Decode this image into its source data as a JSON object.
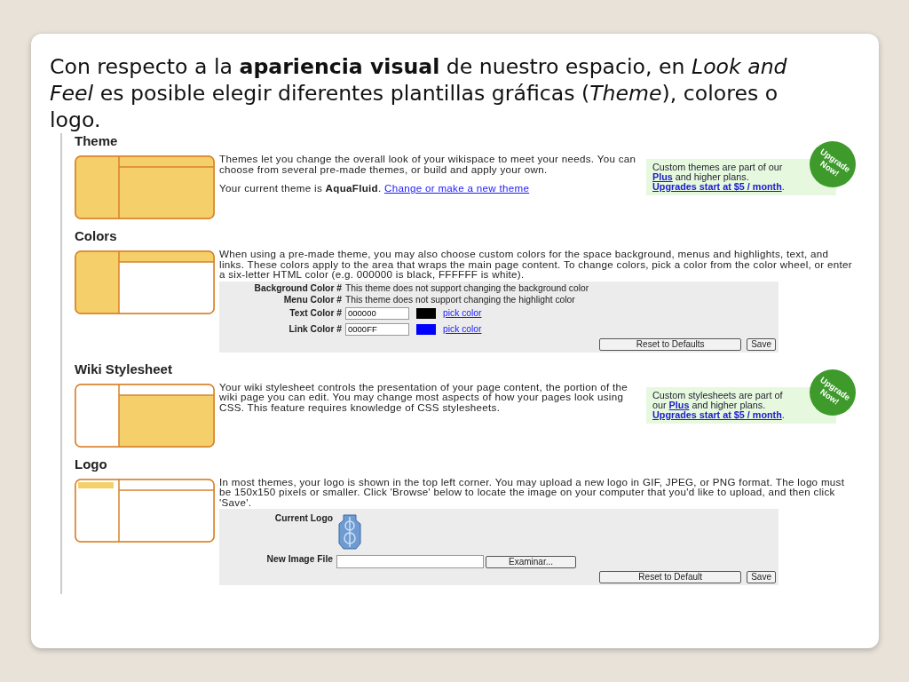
{
  "intro": "Con respecto a la **apariencia visual** de nuestro espacio, en *Look and Feel* es posible elegir diferentes plantillas gráficas (*Theme*), colores o logo.",
  "sections": [
    {
      "title": "Theme",
      "kind": "all",
      "description": "Themes let you change the overall look of your wikispace to meet your needs. You can choose from several pre-made themes, or build and apply your own.",
      "current": "Your current theme is **AquaFluid**.",
      "current_link": "Change or make a new theme",
      "upgrade": {
        "parts": [
          {
            "kind": "text",
            "text": "Custom themes are part of our"
          },
          {
            "kind": "link",
            "text": "Plus"
          },
          {
            "kind": "text",
            "text": "and higher plans."
          },
          {
            "kind": "link",
            "text": "Upgrades start at $5 / month"
          },
          {
            "kind": "text",
            "text": "."
          }
        ],
        "badge": "Upgrade Now!"
      }
    },
    {
      "title": "Colors",
      "kind": "frame",
      "description": "When using a pre-made theme, you may also choose custom colors for the space background, menus and highlights, text, and links. These colors apply to the area that wraps the main page content. To change colors, pick a color from the color wheel, or enter a six-letter HTML color (e.g. 000000 is black, FFFFFF is white).",
      "color_settings": {
        "rows": [
          {
            "kind": "note",
            "label": "Background Color #",
            "text": "This theme does not support changing the background color"
          },
          {
            "kind": "note",
            "label": "Menu Color #",
            "text": "This theme does not support changing the highlight color"
          },
          {
            "kind": "picker",
            "label": "Text Color #",
            "value": "000000",
            "color": "#000000",
            "link": "pick color"
          },
          {
            "kind": "picker",
            "label": "Link Color #",
            "value": "0000FF",
            "color": "#0000ff",
            "link": "pick color"
          }
        ],
        "buttons": [
          "Reset to Defaults",
          "Save"
        ]
      }
    },
    {
      "title": "Wiki Stylesheet",
      "kind": "content",
      "description": "Your wiki stylesheet controls the presentation of your page content, the portion of the wiki page you can edit. You may change most aspects of how your pages look using CSS. This feature requires knowledge of CSS stylesheets.",
      "upgrade": {
        "parts": [
          {
            "kind": "text",
            "text": "Custom stylesheets are part of our"
          },
          {
            "kind": "link",
            "text": "Plus"
          },
          {
            "kind": "text",
            "text": "and higher plans."
          },
          {
            "kind": "link",
            "text": "Upgrades start at $5 / month"
          },
          {
            "kind": "text",
            "text": "."
          }
        ],
        "badge": "Upgrade Now!"
      }
    },
    {
      "title": "Logo",
      "kind": "logo",
      "description": "In most themes, your logo is shown in the top left corner. You may upload a new logo in GIF, JPEG, or PNG format. The logo must be 150x150 pixels or smaller. Click 'Browse' below to locate the image on your computer that you'd like to upload, and then click 'Save'.",
      "logo_settings": {
        "current_label": "Current Logo",
        "file_label": "New Image File",
        "browse": "Examinar...",
        "buttons": [
          "Reset to Default",
          "Save"
        ]
      }
    }
  ]
}
